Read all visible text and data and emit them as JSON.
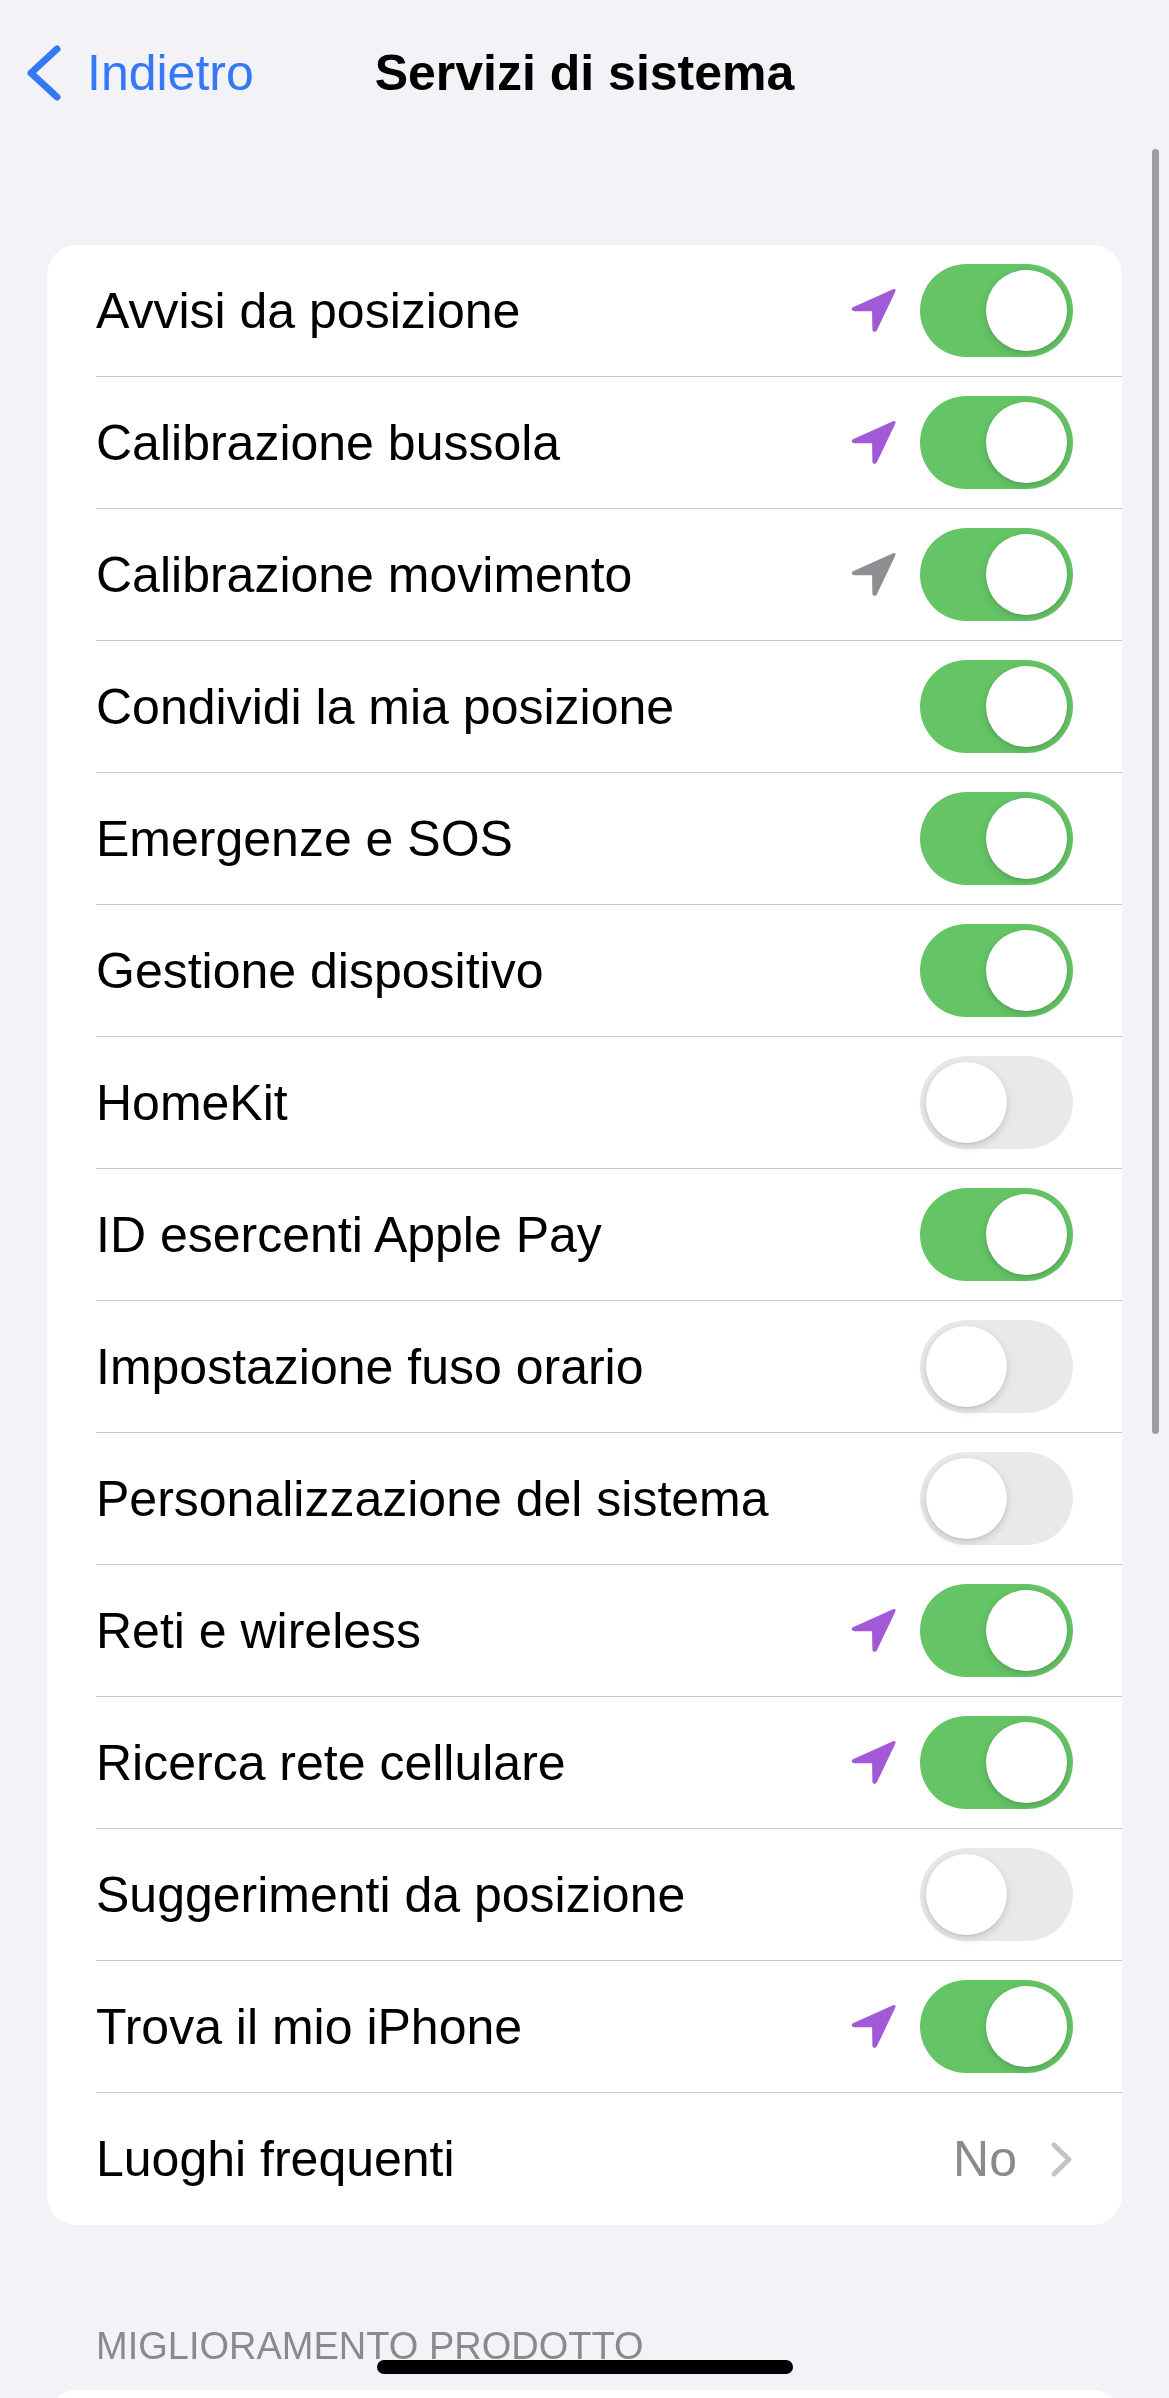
{
  "nav_bar": {
    "back_label": "Indietro",
    "title": "Servizi di sistema"
  },
  "settings": [
    {
      "kind": "toggle",
      "label": "Avvisi da posizione",
      "on": true,
      "location_icon": {
        "color": "#a259d8"
      }
    },
    {
      "kind": "toggle",
      "label": "Calibrazione bussola",
      "on": true,
      "location_icon": {
        "color": "#a259d8"
      }
    },
    {
      "kind": "toggle",
      "label": "Calibrazione movimento",
      "on": true,
      "location_icon": {
        "color": "#8e8e93"
      }
    },
    {
      "kind": "toggle",
      "label": "Condividi la mia posizione",
      "on": true
    },
    {
      "kind": "toggle",
      "label": "Emergenze e SOS",
      "on": true
    },
    {
      "kind": "toggle",
      "label": "Gestione dispositivo",
      "on": true
    },
    {
      "kind": "toggle",
      "label": "HomeKit",
      "on": false
    },
    {
      "kind": "toggle",
      "label": "ID esercenti Apple Pay",
      "on": true
    },
    {
      "kind": "toggle",
      "label": "Impostazione fuso orario",
      "on": false
    },
    {
      "kind": "toggle",
      "label": "Personalizzazione del sistema",
      "on": false
    },
    {
      "kind": "toggle",
      "label": "Reti e wireless",
      "on": true,
      "location_icon": {
        "color": "#a259d8"
      }
    },
    {
      "kind": "toggle",
      "label": "Ricerca rete cellulare",
      "on": true,
      "location_icon": {
        "color": "#a259d8"
      }
    },
    {
      "kind": "toggle",
      "label": "Suggerimenti da posizione",
      "on": false
    },
    {
      "kind": "toggle",
      "label": "Trova il mio iPhone",
      "on": true,
      "location_icon": {
        "color": "#a259d8"
      }
    },
    {
      "kind": "link",
      "label": "Luoghi frequenti",
      "value": "No"
    }
  ],
  "product_improvement_section": {
    "header": "MIGLIORAMENTO PRODOTTO"
  }
}
